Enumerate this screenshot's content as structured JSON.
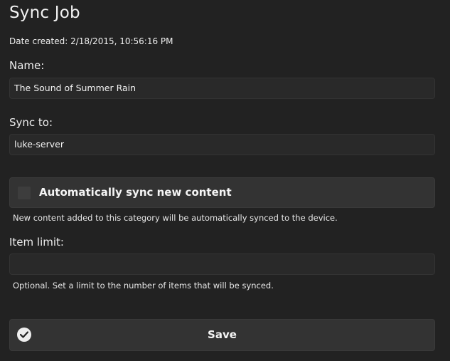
{
  "page": {
    "title": "Sync Job",
    "date_created": "Date created: 2/18/2015, 10:56:16 PM"
  },
  "form": {
    "name_label": "Name:",
    "name_value": "The Sound of Summer Rain",
    "sync_to_label": "Sync to:",
    "sync_to_value": "luke-server",
    "auto_sync": {
      "label": "Automatically sync new content",
      "checked": false,
      "help": "New content added to this category will be automatically synced to the device."
    },
    "item_limit_label": "Item limit:",
    "item_limit_value": "",
    "item_limit_help": "Optional. Set a limit to the number of items that will be synced."
  },
  "actions": {
    "save_label": "Save",
    "save_icon": "check-circle-icon"
  },
  "colors": {
    "background": "#222222",
    "field_background": "#292929",
    "panel_background": "#333333",
    "text": "#ffffff"
  }
}
